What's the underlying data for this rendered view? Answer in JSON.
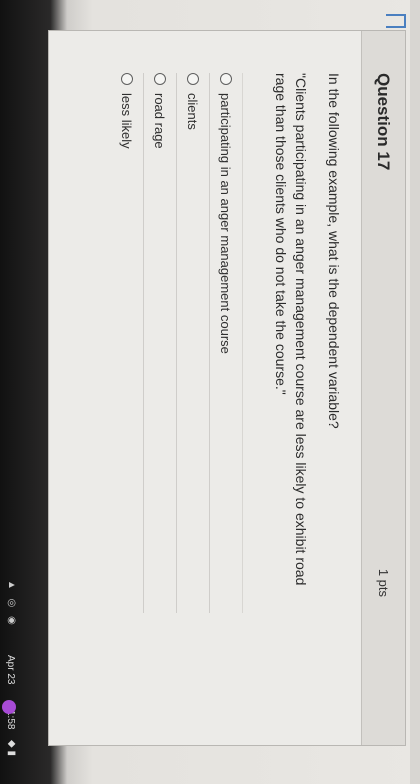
{
  "question": {
    "title": "Question 17",
    "points": "1 pts",
    "prompt": "In the following example, what is the dependent variable?",
    "quote": "\"Clients participating in an anger management course are less likely to exhibit road rage than those clients who do not take the course.\""
  },
  "answers": [
    {
      "label": "participating in an anger management course"
    },
    {
      "label": "clients"
    },
    {
      "label": "road rage"
    },
    {
      "label": "less likely"
    }
  ],
  "taskbar": {
    "tray": "▲ ◎ ◉",
    "date": "Apr 23",
    "time": "1:58",
    "status": "◆ ▮"
  },
  "colors": {
    "accent": "#4a7fc0",
    "background": "#e9e7e3"
  }
}
